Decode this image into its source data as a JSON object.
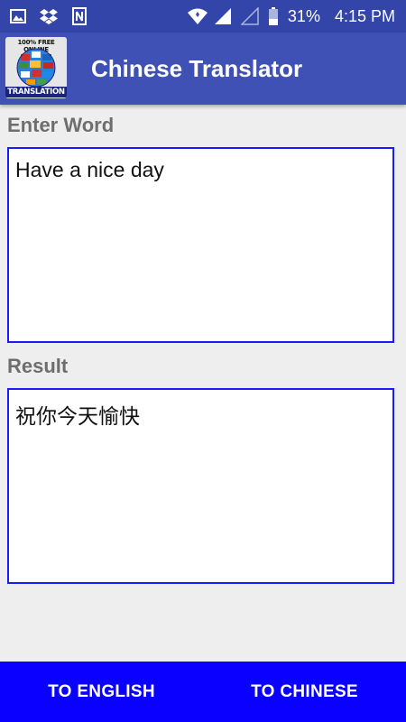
{
  "status_bar": {
    "battery_percent": "31%",
    "time": "4:15 PM",
    "icons": [
      "image-icon",
      "dropbox-icon",
      "notification-icon",
      "wifi-icon",
      "signal-icon",
      "signal-empty-icon",
      "battery-icon"
    ]
  },
  "app_bar": {
    "title": "Chinese Translator",
    "logo_top_text": "100% FREE ONLINE",
    "logo_bottom_text": "TRANSLATION"
  },
  "input": {
    "label": "Enter Word",
    "value": "Have a nice day"
  },
  "output": {
    "label": "Result",
    "value": "祝你今天愉快"
  },
  "buttons": {
    "to_english": "TO ENGLISH",
    "to_chinese": "TO CHINESE"
  },
  "colors": {
    "status_bar": "#3345a8",
    "app_bar": "#3f51b5",
    "box_border": "#1a1aff",
    "bottom_bar": "#0a00ff",
    "background": "#eeeeee"
  }
}
